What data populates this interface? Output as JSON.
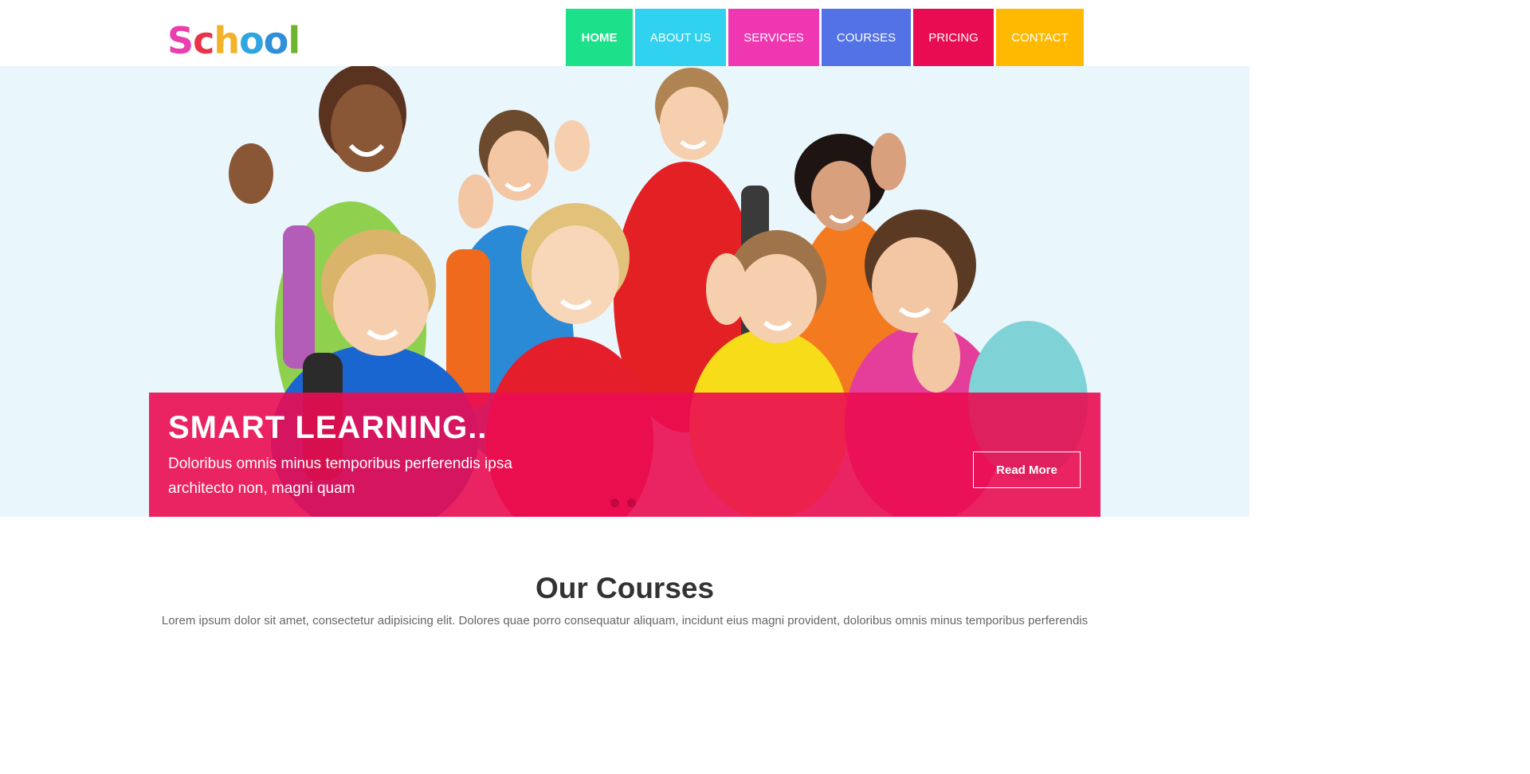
{
  "logo": {
    "letters": [
      {
        "char": "S",
        "color": "#ea3fae"
      },
      {
        "char": "c",
        "color": "#e8334a"
      },
      {
        "char": "h",
        "color": "#f2b32a"
      },
      {
        "char": "o",
        "color": "#2fa6e0"
      },
      {
        "char": "o",
        "color": "#2f8fd8"
      },
      {
        "char": "l",
        "color": "#6cb52d"
      }
    ]
  },
  "nav": {
    "items": [
      {
        "label": "HOME",
        "color": "#1de08a",
        "active": true
      },
      {
        "label": "ABOUT US",
        "color": "#30d2ef",
        "active": false
      },
      {
        "label": "SERVICES",
        "color": "#ee37b0",
        "active": false
      },
      {
        "label": "COURSES",
        "color": "#5272e6",
        "active": false
      },
      {
        "label": "PRICING",
        "color": "#ea0c52",
        "active": false
      },
      {
        "label": "CONTACT",
        "color": "#ffb900",
        "active": false
      }
    ]
  },
  "hero": {
    "image": "group-of-smiling-schoolchildren-giving-thumbs-up",
    "caption": {
      "title": "SMART LEARNING..",
      "text": "Doloribus omnis minus temporibus perferendis ipsa architecto non, magni quam",
      "button": "Read More"
    },
    "slider_dots": 2,
    "caption_color": "#ea0c52"
  },
  "courses": {
    "title": "Our Courses",
    "text": "Lorem ipsum dolor sit amet, consectetur adipisicing elit. Dolores quae porro consequatur aliquam, incidunt eius magni provident, doloribus omnis minus temporibus perferendis"
  }
}
